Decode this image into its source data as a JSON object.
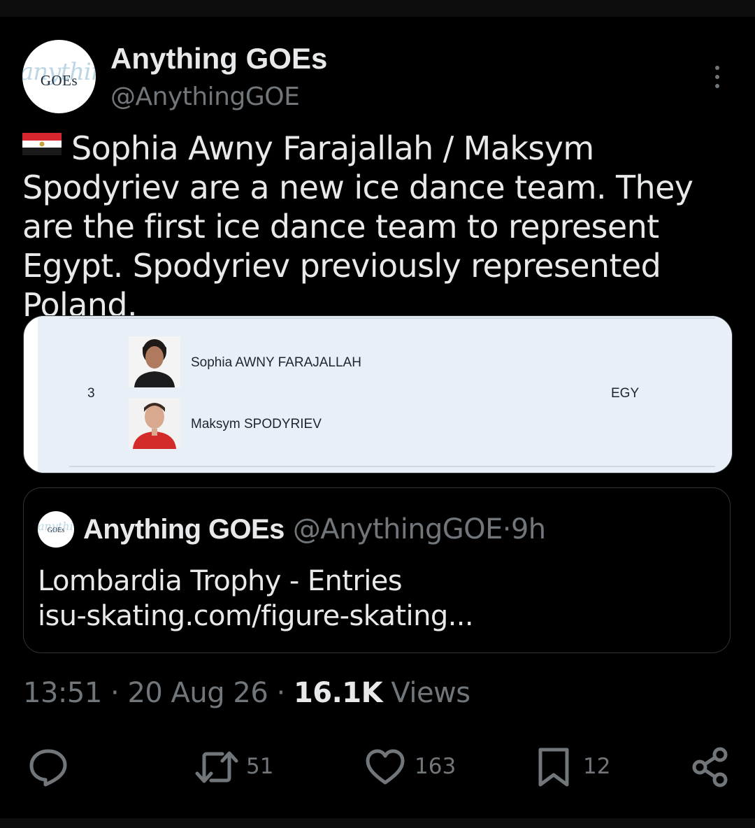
{
  "tweet": {
    "author": {
      "display_name": "Anything GOEs",
      "handle": "@AnythingGOE",
      "avatar_text": "GOEs",
      "avatar_script": "anything"
    },
    "flag": "Egypt",
    "text": "Sophia Awny Farajallah / Maksym Spodyriev are a new ice dance team. They are the first ice dance team to represent Egypt. Spodyriev previously represented Poland.",
    "media": {
      "rank": "3",
      "skater_1": "Sophia AWNY FARAJALLAH",
      "skater_2": "Maksym SPODYRIEV",
      "nation": "EGY"
    },
    "quoted": {
      "display_name": "Anything GOEs",
      "handle": "@AnythingGOE",
      "separator": "·",
      "time": "9h",
      "line_1": "Lombardia Trophy - Entries",
      "line_2": "isu-skating.com/figure-skating..."
    },
    "meta": {
      "time": "13:51",
      "dot_1": "·",
      "date": "20 Aug 26",
      "dot_2": "·",
      "views_count": "16.1K",
      "views_label": "Views"
    },
    "actions": {
      "reply_icon": "speech-bubble-icon",
      "retweet_count": "51",
      "like_count": "163",
      "bookmark_count": "12",
      "share_icon": "share-icon"
    }
  },
  "colors": {
    "background": "#000000",
    "text_primary": "#e7e9ea",
    "text_secondary": "#71767b",
    "border": "#2f3336"
  }
}
